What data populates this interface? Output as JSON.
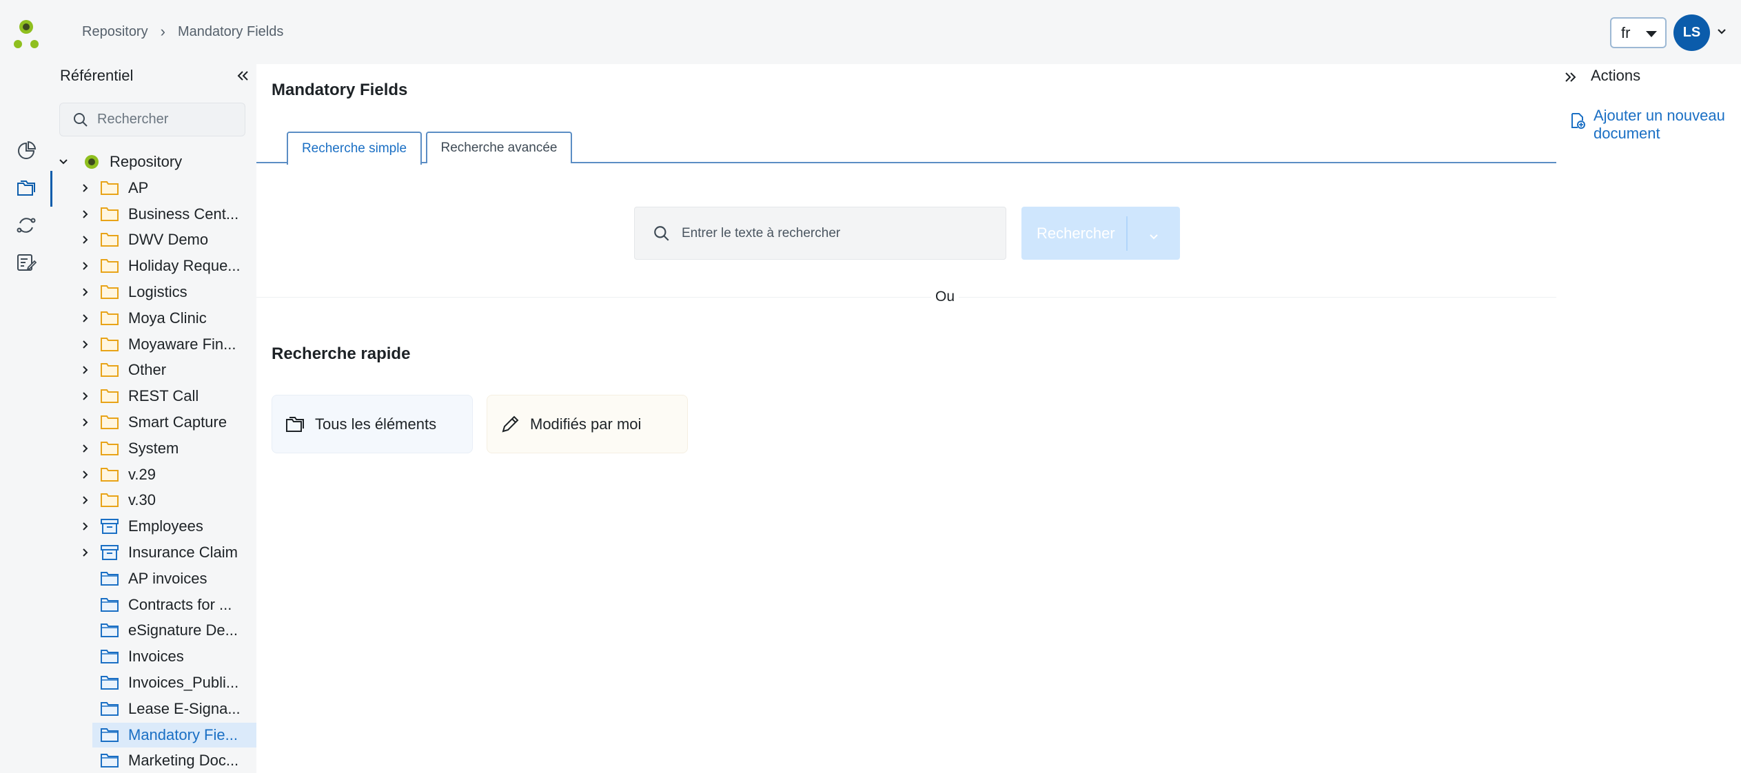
{
  "header": {
    "breadcrumb": [
      "Repository",
      "Mandatory Fields"
    ],
    "language": "fr",
    "user_initials": "LS"
  },
  "sidebar": {
    "title": "Référentiel",
    "search_placeholder": "Rechercher",
    "root_label": "Repository",
    "items": [
      {
        "label": "AP",
        "icon": "folder-icon",
        "expandable": true
      },
      {
        "label": "Business Cent...",
        "icon": "folder-icon",
        "expandable": true
      },
      {
        "label": "DWV Demo",
        "icon": "folder-icon",
        "expandable": true
      },
      {
        "label": "Holiday Reque...",
        "icon": "folder-icon",
        "expandable": true
      },
      {
        "label": "Logistics",
        "icon": "folder-icon",
        "expandable": true
      },
      {
        "label": "Moya Clinic",
        "icon": "folder-icon",
        "expandable": true
      },
      {
        "label": "Moyaware Fin...",
        "icon": "folder-icon",
        "expandable": true
      },
      {
        "label": "Other",
        "icon": "folder-icon",
        "expandable": true
      },
      {
        "label": "REST Call",
        "icon": "folder-icon",
        "expandable": true
      },
      {
        "label": "Smart Capture",
        "icon": "folder-icon",
        "expandable": true
      },
      {
        "label": "System",
        "icon": "folder-icon",
        "expandable": true
      },
      {
        "label": "v.29",
        "icon": "folder-icon",
        "expandable": true
      },
      {
        "label": "v.30",
        "icon": "folder-icon",
        "expandable": true
      },
      {
        "label": "Employees",
        "icon": "archive-icon",
        "expandable": true
      },
      {
        "label": "Insurance Claim",
        "icon": "archive-icon",
        "expandable": true
      },
      {
        "label": "AP invoices",
        "icon": "search-folder-icon",
        "expandable": false
      },
      {
        "label": "Contracts for ...",
        "icon": "search-folder-icon",
        "expandable": false
      },
      {
        "label": "eSignature De...",
        "icon": "search-folder-icon",
        "expandable": false
      },
      {
        "label": "Invoices",
        "icon": "search-folder-icon",
        "expandable": false
      },
      {
        "label": "Invoices_Publi...",
        "icon": "search-folder-icon",
        "expandable": false
      },
      {
        "label": "Lease E-Signa...",
        "icon": "search-folder-icon",
        "expandable": false
      },
      {
        "label": "Mandatory Fie...",
        "icon": "search-folder-icon",
        "expandable": false,
        "selected": true
      },
      {
        "label": "Marketing Doc...",
        "icon": "search-folder-icon",
        "expandable": false
      }
    ]
  },
  "main": {
    "title": "Mandatory Fields",
    "tabs": [
      "Recherche simple",
      "Recherche avancée"
    ],
    "active_tab": "Recherche simple",
    "search_placeholder": "Entrer le texte à rechercher",
    "search_button": "Rechercher",
    "or_label": "Ou",
    "quick_title": "Recherche rapide",
    "quick_items": [
      "Tous les éléments",
      "Modifiés par moi"
    ]
  },
  "actions": {
    "title": "Actions",
    "add_document": "Ajouter un nouveau document"
  },
  "colors": {
    "accent": "#0b5cab",
    "link": "#1a6fc4",
    "folder": "#e8a317",
    "logo_green": "#8fbf1f"
  }
}
